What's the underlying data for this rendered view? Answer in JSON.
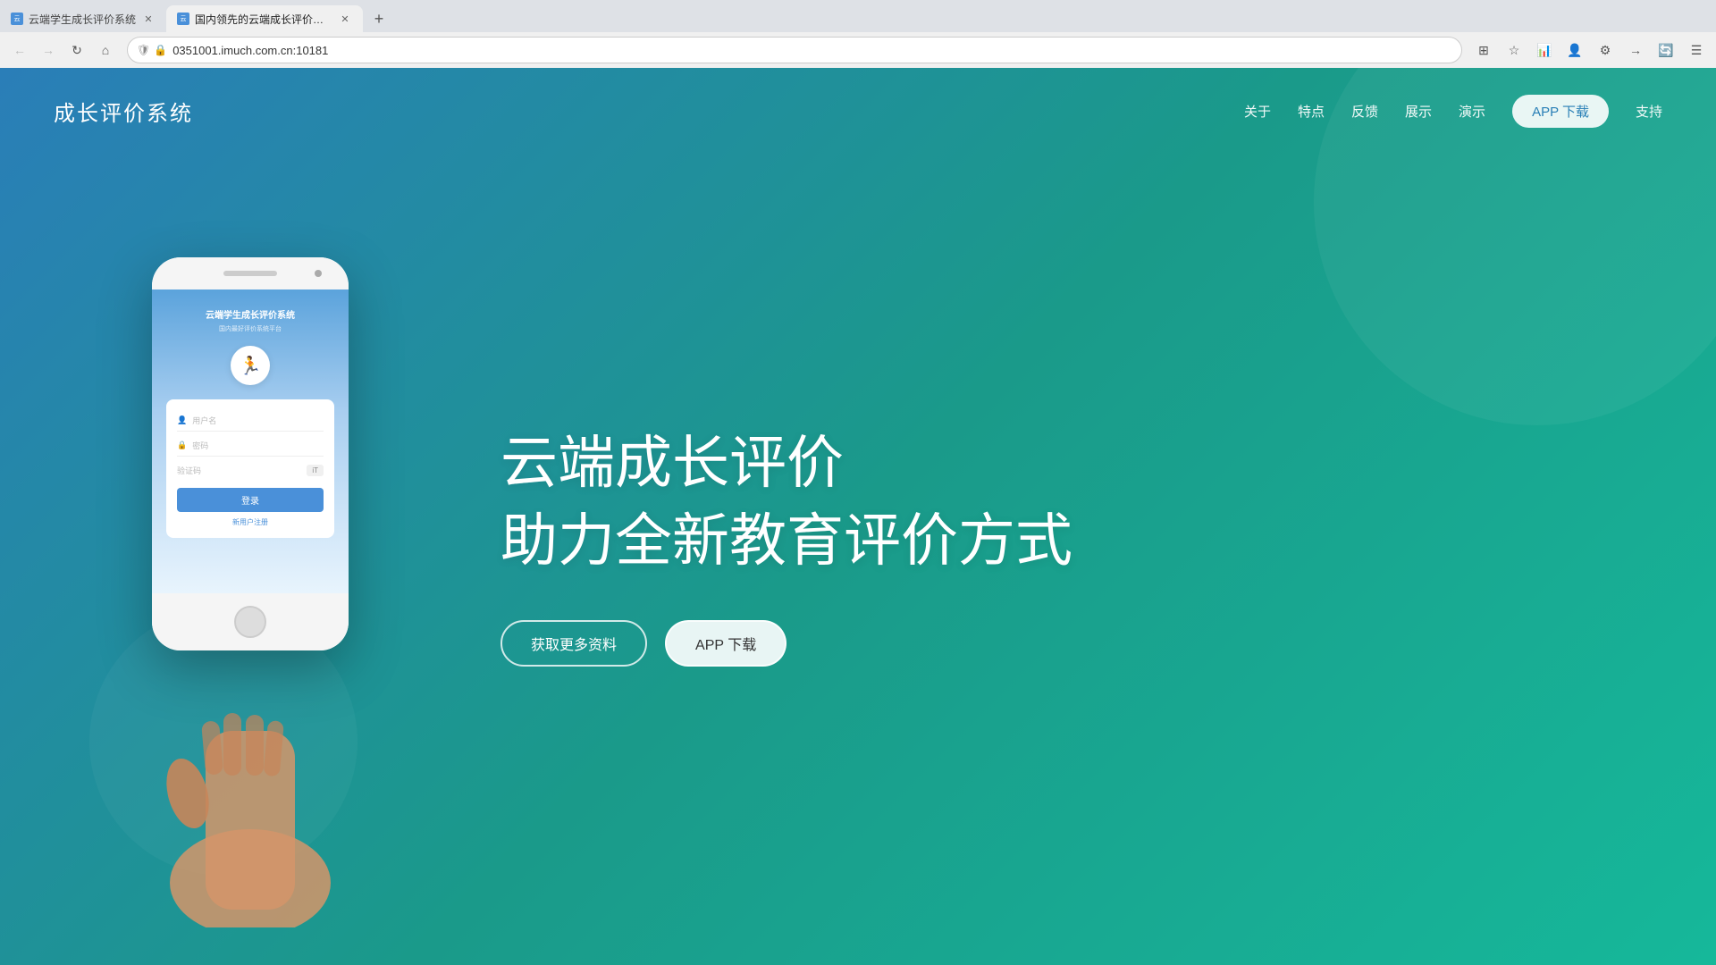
{
  "browser": {
    "tabs": [
      {
        "id": "tab1",
        "title": "云端学生成长评价系统",
        "active": false,
        "favicon_color": "#4a90d9"
      },
      {
        "id": "tab2",
        "title": "国内领先的云端成长评价系统",
        "active": true,
        "favicon_color": "#4a90d9"
      }
    ],
    "new_tab_label": "+",
    "address": "0351001.imuch.com.cn:10181",
    "nav_buttons": {
      "back": "←",
      "forward": "→",
      "reload": "↻",
      "home": "⌂"
    }
  },
  "site": {
    "logo": "成长评价系统",
    "nav": {
      "items": [
        {
          "label": "关于",
          "active": false
        },
        {
          "label": "特点",
          "active": false
        },
        {
          "label": "反馈",
          "active": false
        },
        {
          "label": "展示",
          "active": false
        },
        {
          "label": "演示",
          "active": false
        },
        {
          "label": "APP 下载",
          "active": true
        },
        {
          "label": "支持",
          "active": false
        }
      ]
    },
    "hero": {
      "title_line1": "云端成长评价",
      "title_line2": "助力全新教育评价方式",
      "btn_info": "获取更多资料",
      "btn_download": "APP 下载"
    },
    "phone_app": {
      "title": "云端学生成长评价系统",
      "subtitle": "国内最好评价系统平台",
      "username_placeholder": "用户名",
      "password_placeholder": "密码",
      "captcha_placeholder": "验证码",
      "captcha_value": "iT",
      "login_btn": "登录",
      "register_link": "新用户注册"
    }
  }
}
